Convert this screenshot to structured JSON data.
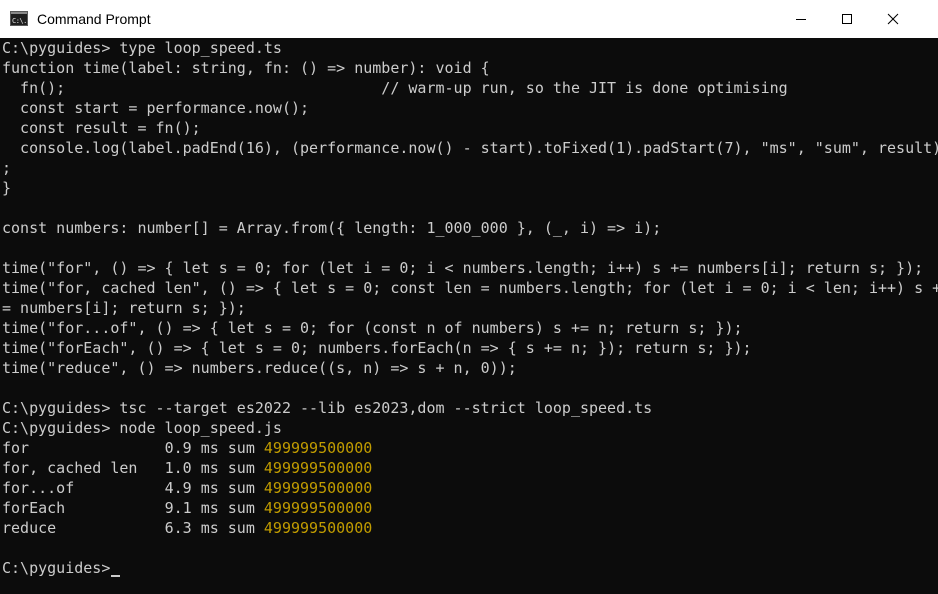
{
  "window": {
    "title": "Command Prompt",
    "icon": "command-prompt-icon",
    "icon_glyph": "C:\\.",
    "controls": [
      "minimize",
      "maximize",
      "close"
    ]
  },
  "colors": {
    "background": "#0c0c0c",
    "text": "#cccccc",
    "number_highlight": "#c19c00",
    "titlebar": "#ffffff"
  },
  "console": {
    "lines": [
      "C:\\pyguides> type loop_speed.ts",
      "function time(label: string, fn: () => number): void {",
      "  fn();                                   // warm-up run, so the JIT is done optimising",
      "  const start = performance.now();",
      "  const result = fn();",
      "  console.log(label.padEnd(16), (performance.now() - start).toFixed(1).padStart(7), \"ms\", \"sum\", result)",
      ";",
      "}",
      "",
      "const numbers: number[] = Array.from({ length: 1_000_000 }, (_, i) => i);",
      "",
      "time(\"for\", () => { let s = 0; for (let i = 0; i < numbers.length; i++) s += numbers[i]; return s; });",
      "time(\"for, cached len\", () => { let s = 0; const len = numbers.length; for (let i = 0; i < len; i++) s +",
      "= numbers[i]; return s; });",
      "time(\"for...of\", () => { let s = 0; for (const n of numbers) s += n; return s; });",
      "time(\"forEach\", () => { let s = 0; numbers.forEach(n => { s += n; }); return s; });",
      "time(\"reduce\", () => numbers.reduce((s, n) => s + n, 0));",
      "",
      "C:\\pyguides> tsc --target es2022 --lib es2023,dom --strict loop_speed.ts",
      "C:\\pyguides> node loop_speed.js"
    ],
    "results": [
      {
        "label": "for               ",
        "time": "0.9",
        "unit": "ms",
        "sum_label": "sum",
        "value": "499999500000"
      },
      {
        "label": "for, cached len   ",
        "time": "1.0",
        "unit": "ms",
        "sum_label": "sum",
        "value": "499999500000"
      },
      {
        "label": "for...of          ",
        "time": "4.9",
        "unit": "ms",
        "sum_label": "sum",
        "value": "499999500000"
      },
      {
        "label": "forEach           ",
        "time": "9.1",
        "unit": "ms",
        "sum_label": "sum",
        "value": "499999500000"
      },
      {
        "label": "reduce            ",
        "time": "6.3",
        "unit": "ms",
        "sum_label": "sum",
        "value": "499999500000"
      }
    ],
    "prompt": "C:\\pyguides>"
  }
}
